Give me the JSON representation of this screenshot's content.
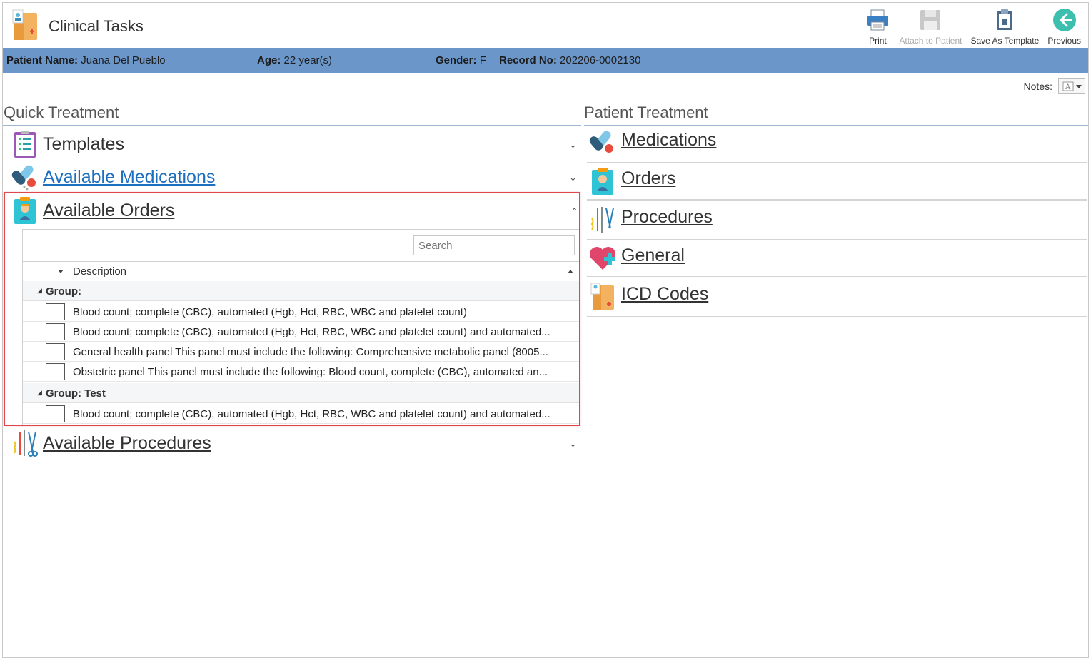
{
  "app": {
    "title": "Clinical Tasks"
  },
  "toolbar": {
    "print": "Print",
    "attach": "Attach to Patient",
    "save_template": "Save As Template",
    "previous": "Previous"
  },
  "patient": {
    "name_label": "Patient Name:",
    "name": "Juana Del Pueblo",
    "age_label": "Age:",
    "age": "22 year(s)",
    "gender_label": "Gender:",
    "gender": "F",
    "record_label": "Record No:",
    "record": "202206-0002130"
  },
  "notes": {
    "label": "Notes:"
  },
  "quick_treatment": {
    "title": "Quick Treatment",
    "templates": "Templates",
    "available_medications": "Available Medications",
    "available_orders": "Available Orders",
    "available_procedures": "Available Procedures",
    "search_placeholder": "Search",
    "column_description": "Description",
    "groups": [
      {
        "label": "Group:",
        "items": [
          "Blood count; complete (CBC), automated (Hgb, Hct, RBC, WBC and platelet count)",
          "Blood count; complete (CBC), automated (Hgb, Hct, RBC, WBC and platelet count) and automated...",
          "General health panel This panel must include the following: Comprehensive metabolic panel (8005...",
          "Obstetric panel This panel must include the following: Blood count, complete (CBC), automated an..."
        ]
      },
      {
        "label": "Group: Test",
        "items": [
          "Blood count; complete (CBC), automated (Hgb, Hct, RBC, WBC and platelet count) and automated..."
        ]
      }
    ]
  },
  "patient_treatment": {
    "title": "Patient Treatment",
    "items": [
      "Medications",
      "Orders",
      "Procedures",
      "General",
      "ICD Codes"
    ]
  },
  "colors": {
    "patient_bar": "#6b96c9",
    "highlight_border": "#e0474c",
    "link_blue": "#1f6fc1"
  }
}
